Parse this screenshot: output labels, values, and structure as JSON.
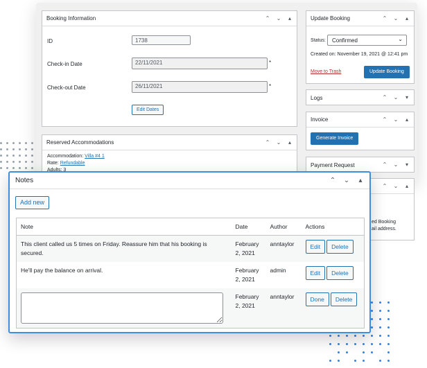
{
  "booking_info": {
    "title": "Booking Information",
    "id_label": "ID",
    "id_value": "1738",
    "checkin_label": "Check-in Date",
    "checkin_value": "22/11/2021",
    "checkout_label": "Check-out Date",
    "checkout_value": "26/11/2021",
    "required_mark": "*",
    "edit_dates": "Edit Dates"
  },
  "reserved": {
    "title": "Reserved Accommodations",
    "accommodation_label": "Accommodation:",
    "accommodation_value": "Villa #4 1",
    "rate_label": "Rate:",
    "rate_value": "Refundable",
    "adults": "Adults: 3"
  },
  "update_booking": {
    "title": "Update Booking",
    "status_label": "Status:",
    "status_value": "Confirmed",
    "created_on": "Created on: November 19, 2021 @ 12:41 pm",
    "trash": "Move to Trash",
    "update_button": "Update Booking"
  },
  "logs": {
    "title": "Logs"
  },
  "invoice": {
    "title": "Invoice",
    "generate_button": "Generate Invoice"
  },
  "payment_request": {
    "title": "Payment Request"
  },
  "partial": {
    "line1": "ed Booking",
    "line2": "ail address."
  },
  "notes": {
    "title": "Notes",
    "add_button": "Add new",
    "columns": [
      "Note",
      "Date",
      "Author",
      "Actions"
    ],
    "rows": [
      {
        "note": "This client called us 5 times on Friday. Reassure him that his booking is secured.",
        "date": "February 2, 2021",
        "author": "anntaylor",
        "btn1": "Edit",
        "btn2": "Delete"
      },
      {
        "note": "He'll pay the balance on arrival.",
        "date": "February 2, 2021",
        "author": "admin",
        "btn1": "Edit",
        "btn2": "Delete"
      },
      {
        "note": "",
        "date": "February 2, 2021",
        "author": "anntaylor",
        "btn1": "Done",
        "btn2": "Delete"
      }
    ]
  },
  "icons": {
    "up": "chevron-up-icon",
    "down": "chevron-down-icon",
    "toggle": "toggle-arrow-icon"
  },
  "colors": {
    "accent": "#2271b1",
    "highlight_border": "#3b8ee0",
    "danger": "#b32d2e"
  }
}
